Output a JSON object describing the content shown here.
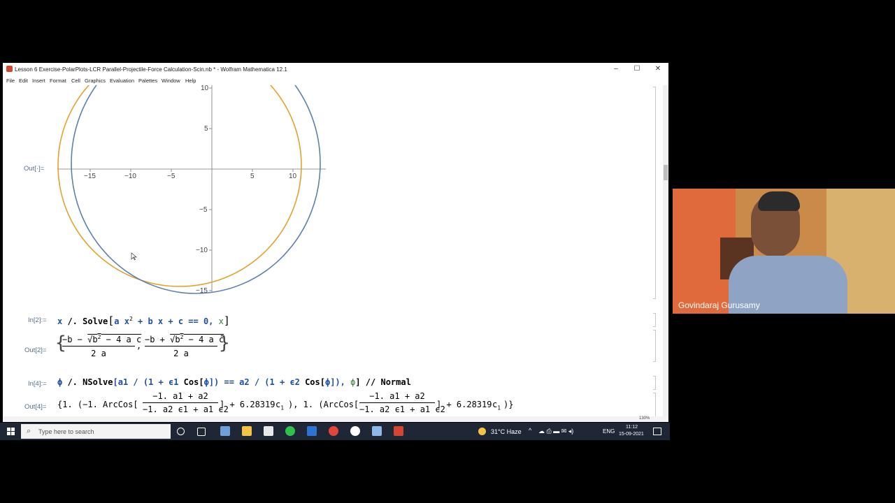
{
  "window": {
    "title": "Lesson 6 Exercise-PolarPlots-LCR Parallel-Projectile-Force Calculation-Scin.nb * - Wolfram Mathematica 12.1",
    "controls": {
      "minimize": "–",
      "maximize": "☐",
      "close": "✕"
    }
  },
  "menu": [
    "File",
    "Edit",
    "Insert",
    "Format",
    "Cell",
    "Graphics",
    "Evaluation",
    "Palettes",
    "Window",
    "Help"
  ],
  "plot": {
    "out_label": "Out[·]=",
    "x_ticks": [
      "−15",
      "−10",
      "−5",
      "5",
      "10"
    ],
    "y_ticks": [
      "10",
      "5",
      "−5",
      "−10",
      "−15"
    ],
    "colors": {
      "curve1": "#e2a32d",
      "curve2": "#5e81ac"
    }
  },
  "cells": {
    "in2_label": "In[2]:=",
    "in2_code": {
      "x": "x",
      "op": " /. ",
      "fn": "Solve",
      "a1": "a x",
      "sup": "2",
      "rest": " + b x + c == 0, ",
      "xv": "x"
    },
    "out2_label": "Out[2]=",
    "out2": {
      "num1_a": "−b − ",
      "num1_b": "b",
      "num1_c": "2",
      "num1_d": " − 4 a c",
      "den1": "2 a",
      "num2_a": "−b + ",
      "num2_b": "b",
      "num2_c": "2",
      "num2_d": " − 4 a c",
      "den2": "2 a"
    },
    "in4_label": "In[4]:=",
    "in4_code": {
      "phi": "ϕ",
      "op": " /. ",
      "fn": "NSolve",
      "body1": "[a1 / (1 + ",
      "e1": "ϵ1",
      "body2": " Cos[",
      "phi2": "ϕ",
      "body3": "]) == a2 / (1 + ",
      "e2": "ϵ2",
      "body4": " Cos[",
      "phi3": "ϕ",
      "body5": "]), ",
      "phi4": "ϕ",
      "body6": "] // Normal"
    },
    "out4_label": "Out[4]=",
    "out4": {
      "part1": "{1. (−1. ArcCos[",
      "frac1_num": "−1. a1 + a2",
      "frac1_den": "−1. a2 ϵ1 + a1 ϵ2",
      "part2": "] + 6.28319 ",
      "c1": "c",
      "sub1": "1",
      "part3": "), 1. (ArcCos[",
      "frac2_num": "−1. a1 + a2",
      "frac2_den": "−1. a2 ϵ1 + a1 ϵ2",
      "part4": "] + 6.28319 ",
      "c2": "c",
      "sub2": "1",
      "part5": ")}"
    }
  },
  "status": {
    "zoom": "130%"
  },
  "taskbar": {
    "search_placeholder": "Type here to search",
    "weather": "31°C Haze",
    "lang": "ENG",
    "time": "11:12",
    "date": "15-09-2021"
  },
  "video": {
    "name": "Govindaraj Gurusamy"
  }
}
